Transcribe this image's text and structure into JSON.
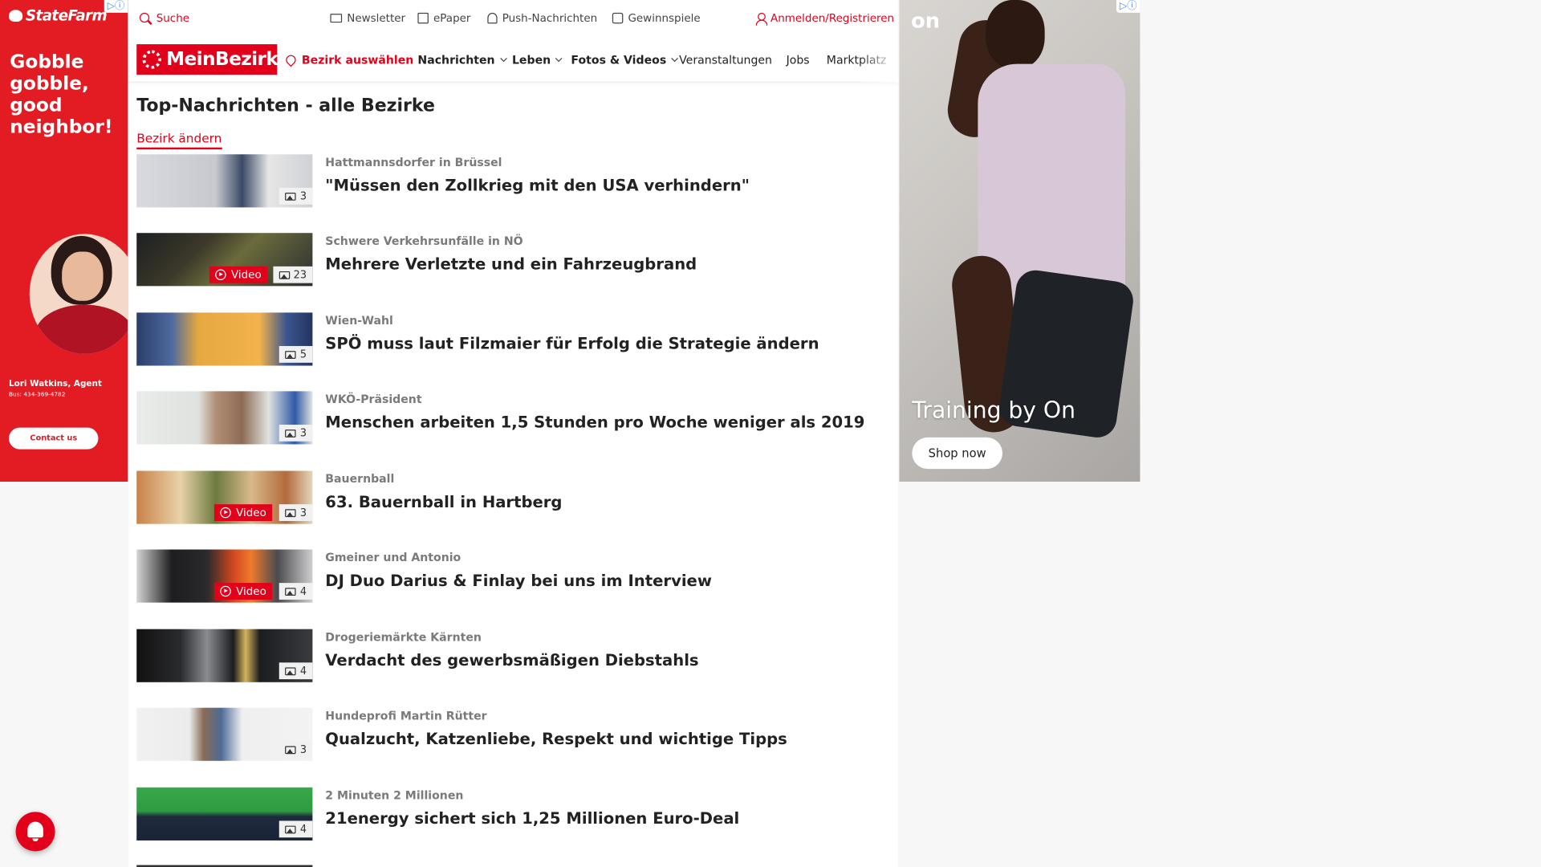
{
  "ads": {
    "left": {
      "brand": "StateFarm",
      "headline": "Gobble gobble, good neighbor!",
      "agent": "Lori Watkins, Agent",
      "phone": "Bus: 434-369-4782",
      "cta": "Contact us",
      "color": "#e31b23"
    },
    "right": {
      "brand": "on",
      "tagline": "Training by On",
      "cta": "Shop now"
    }
  },
  "topbar": {
    "search": "Suche",
    "newsletter": "Newsletter",
    "epaper": "ePaper",
    "push": "Push-Nachrichten",
    "games": "Gewinnspiele",
    "login": "Anmelden/Registrieren"
  },
  "nav": {
    "logo": "MeinBezirk",
    "district": "Bezirk auswählen",
    "items": [
      "Nachrichten",
      "Leben",
      "Fotos & Videos",
      "Veranstaltungen",
      "Jobs",
      "Marktplatz"
    ]
  },
  "page": {
    "title": "Top-Nachrichten - alle Bezirke",
    "change_district": "Bezirk ändern"
  },
  "articles": [
    {
      "kicker": "Hattmannsdorfer in Brüssel",
      "title": "\"Müssen den Zollkrieg mit den USA verhindern\"",
      "images": "3",
      "video": ""
    },
    {
      "kicker": "Schwere Verkehrsunfälle in NÖ",
      "title": "Mehrere Verletzte und ein Fahrzeugbrand",
      "images": "23",
      "video": "Video"
    },
    {
      "kicker": "Wien-Wahl",
      "title": "SPÖ muss laut Filzmaier für Erfolg die Strategie ändern",
      "images": "5",
      "video": ""
    },
    {
      "kicker": "WKÖ-Präsident",
      "title": "Menschen arbeiten 1,5 Stunden pro Woche weniger als 2019",
      "images": "3",
      "video": ""
    },
    {
      "kicker": "Bauernball",
      "title": "63. Bauernball in Hartberg",
      "images": "3",
      "video": "Video"
    },
    {
      "kicker": "Gmeiner und Antonio",
      "title": "DJ Duo Darius & Finlay bei uns im Interview",
      "images": "4",
      "video": "Video"
    },
    {
      "kicker": "Drogeriemärkte Kärnten",
      "title": "Verdacht des gewerbsmäßigen Diebstahls",
      "images": "4",
      "video": ""
    },
    {
      "kicker": "Hundeprofi Martin Rütter",
      "title": "Qualzucht, Katzenliebe, Respekt und wichtige Tipps",
      "images": "3",
      "video": ""
    },
    {
      "kicker": "2 Minuten 2 Millionen",
      "title": "21energy sichert sich 1,25 Millionen Euro-Deal",
      "images": "4",
      "video": ""
    }
  ],
  "colors": {
    "accent": "#e2001a"
  }
}
